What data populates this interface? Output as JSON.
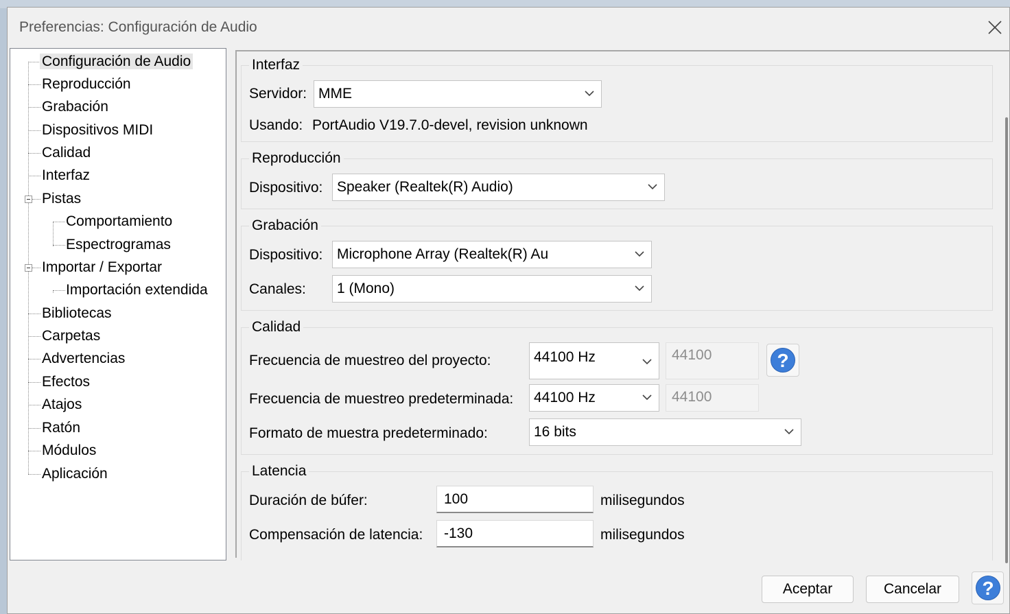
{
  "window": {
    "title": "Preferencias: Configuración de Audio"
  },
  "tree": {
    "items": [
      {
        "label": "Configuración de Audio"
      },
      {
        "label": "Reproducción"
      },
      {
        "label": "Grabación"
      },
      {
        "label": "Dispositivos MIDI"
      },
      {
        "label": "Calidad"
      },
      {
        "label": "Interfaz"
      },
      {
        "label": "Pistas"
      },
      {
        "label": "Comportamiento"
      },
      {
        "label": "Espectrogramas"
      },
      {
        "label": "Importar / Exportar"
      },
      {
        "label": "Importación extendida"
      },
      {
        "label": "Bibliotecas"
      },
      {
        "label": "Carpetas"
      },
      {
        "label": "Advertencias"
      },
      {
        "label": "Efectos"
      },
      {
        "label": "Atajos"
      },
      {
        "label": "Ratón"
      },
      {
        "label": "Módulos"
      },
      {
        "label": "Aplicación"
      }
    ]
  },
  "interfaz": {
    "title": "Interfaz",
    "host_label": "Servidor:",
    "host_value": "MME",
    "using_label": "Usando:",
    "using_value": "PortAudio V19.7.0-devel, revision unknown"
  },
  "playback": {
    "title": "Reproducción",
    "device_label": "Dispositivo:",
    "device_value": "Speaker (Realtek(R) Audio)"
  },
  "recording": {
    "title": "Grabación",
    "device_label": "Dispositivo:",
    "device_value": "Microphone Array (Realtek(R) Au",
    "channels_label": "Canales:",
    "channels_value": "1 (Mono)"
  },
  "quality": {
    "title": "Calidad",
    "project_rate_label": "Frecuencia de muestreo del proyecto:",
    "project_rate_value": "44100 Hz",
    "project_rate_text": "44100",
    "default_rate_label": "Frecuencia de muestreo predeterminada:",
    "default_rate_value": "44100 Hz",
    "default_rate_text": "44100",
    "format_label": "Formato de muestra predeterminado:",
    "format_value": "16 bits",
    "help_glyph": "?"
  },
  "latency": {
    "title": "Latencia",
    "buffer_label": "Duración de búfer:",
    "buffer_value": "100",
    "buffer_unit": "milisegundos",
    "comp_label": "Compensación de latencia:",
    "comp_value": "-130",
    "comp_unit": "milisegundos"
  },
  "footer": {
    "ok_label": "Aceptar",
    "cancel_label": "Cancelar",
    "help_glyph": "?"
  },
  "colors": {
    "accent": "#3d7ed9",
    "background": "#f0f0f0"
  }
}
